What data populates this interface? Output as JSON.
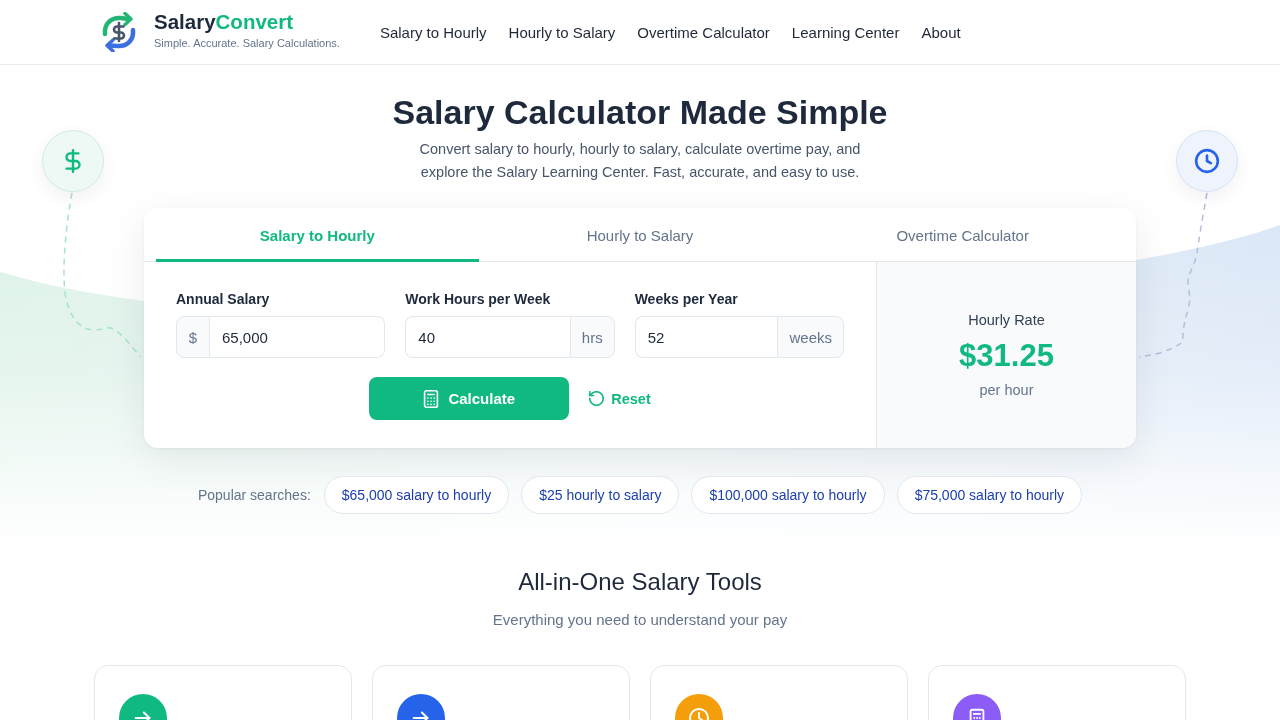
{
  "header": {
    "brand": {
      "name": "Salary",
      "name_accent": "Convert",
      "tagline": "Simple. Accurate. Salary Calculations."
    },
    "nav": [
      {
        "label": "Salary to Hourly"
      },
      {
        "label": "Hourly to Salary"
      },
      {
        "label": "Overtime Calculator"
      },
      {
        "label": "Learning Center"
      },
      {
        "label": "About"
      }
    ]
  },
  "hero": {
    "title": "Salary Calculator Made Simple",
    "subtitle": "Convert salary to hourly, hourly to salary, calculate overtime pay, and explore the Salary Learning Center. Fast, accurate, and easy to use."
  },
  "calculator": {
    "tabs": [
      {
        "label": "Salary to Hourly",
        "selected": true
      },
      {
        "label": "Hourly to Salary",
        "selected": false
      },
      {
        "label": "Overtime Calculator",
        "selected": false
      }
    ],
    "fields": [
      {
        "label": "Annual Salary",
        "prefix": "$",
        "value": "65,000"
      },
      {
        "label": "Work Hours per Week",
        "value": "40",
        "suffix": "hrs"
      },
      {
        "label": "Weeks per Year",
        "value": "52",
        "suffix": "weeks"
      }
    ],
    "calculate_button": "Calculate",
    "reset_button": "Reset",
    "result": {
      "label": "Hourly Rate",
      "value": "$31.25",
      "unit": "per hour"
    }
  },
  "popular_searches": {
    "label": "Popular searches:",
    "links": [
      "$65,000 salary to hourly",
      "$25 hourly to salary",
      "$100,000 salary to hourly",
      "$75,000 salary to hourly"
    ]
  },
  "tools_section": {
    "title": "All-in-One Salary Tools",
    "subtitle": "Everything you need to understand your pay",
    "cards": [
      {
        "kind": "arrow",
        "color": "#10b981"
      },
      {
        "kind": "arrow",
        "color": "#2563eb"
      },
      {
        "kind": "clock",
        "color": "#f59e0b"
      },
      {
        "kind": "calculator",
        "color": "#8b5cf6"
      }
    ]
  }
}
